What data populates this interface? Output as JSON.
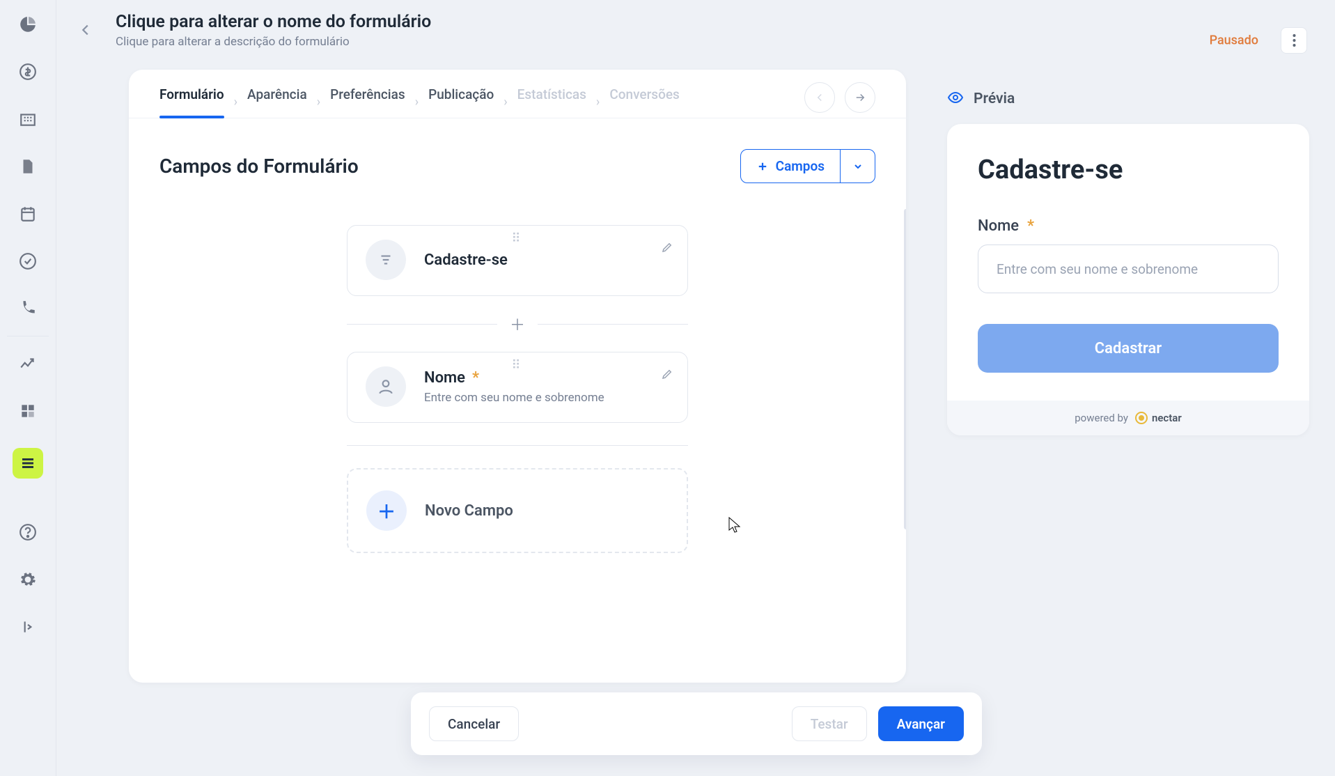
{
  "header": {
    "title": "Clique para alterar o nome do formulário",
    "subtitle": "Clique para alterar a descrição do formulário",
    "status": "Pausado"
  },
  "steps": {
    "items": [
      "Formulário",
      "Aparência",
      "Preferências",
      "Publicação",
      "Estatísticas",
      "Conversões"
    ],
    "active_index": 0,
    "disabled_from": 4
  },
  "content": {
    "heading": "Campos do Formulário",
    "add_button": "Campos",
    "fields": [
      {
        "type": "title",
        "label": "Cadastre-se",
        "required": false,
        "placeholder": ""
      },
      {
        "type": "text",
        "label": "Nome",
        "required": true,
        "placeholder": "Entre com seu nome e sobrenome"
      }
    ],
    "new_field": "Novo Campo"
  },
  "preview": {
    "label": "Prévia",
    "title": "Cadastre-se",
    "field_label": "Nome",
    "field_required": true,
    "input_placeholder": "Entre com seu nome e sobrenome",
    "submit": "Cadastrar",
    "powered_by": "powered by",
    "brand": "nectar"
  },
  "actions": {
    "cancel": "Cancelar",
    "test": "Testar",
    "next": "Avançar"
  }
}
